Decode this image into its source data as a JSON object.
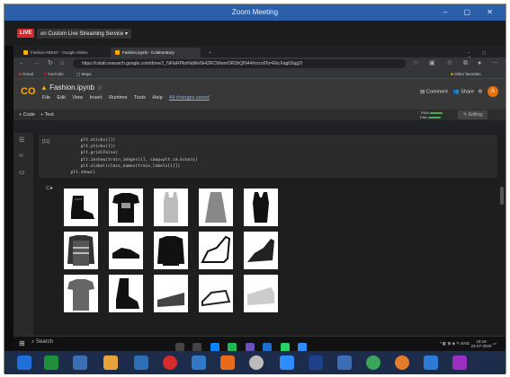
{
  "zoom": {
    "title": "Zoom Meeting",
    "live_badge": "LIVE",
    "live_text": "on Custom Live Streaming Service ▾"
  },
  "browser": {
    "tabs": [
      {
        "label": "Fashion MNIST - Google Slides",
        "color": "#f4b400"
      },
      {
        "label": "Fashion.ipynb - Colaboratory",
        "color": "#f9ab00"
      }
    ],
    "url": "https://colab.research.google.com/drive/1_NFfaRPknNqWe5k42RCWwmORShQlN44#scrollTo=EkcXag6Sqg2l",
    "bookmarks": {
      "gmail": "Gmail",
      "youtube": "YouTube",
      "maps": "Maps",
      "other": "Other favorites"
    }
  },
  "colab": {
    "logo": "CO",
    "notebook_title": "Fashion.ipynb",
    "menu": [
      "File",
      "Edit",
      "View",
      "Insert",
      "Runtime",
      "Tools",
      "Help"
    ],
    "saved": "All changes saved",
    "comment": "Comment",
    "share": "Share",
    "avatar": "A",
    "add_code": "+ Code",
    "add_text": "+ Text",
    "ram": "RAM",
    "disk": "Disk",
    "editing": "Editing"
  },
  "cell": {
    "exec_count": "[11]",
    "code": "      plt.xticks([])\n      plt.yticks([])\n      plt.grid(False)\n      plt.imshow(train_images[i], cmap=plt.cm.binary)\n      plt.xlabel(class_names[train_labels[i]])\n  plt.show()"
  },
  "taskbar": {
    "search": "Search",
    "lang": "ENG",
    "time": "19:19",
    "date": "23-07-2020"
  }
}
